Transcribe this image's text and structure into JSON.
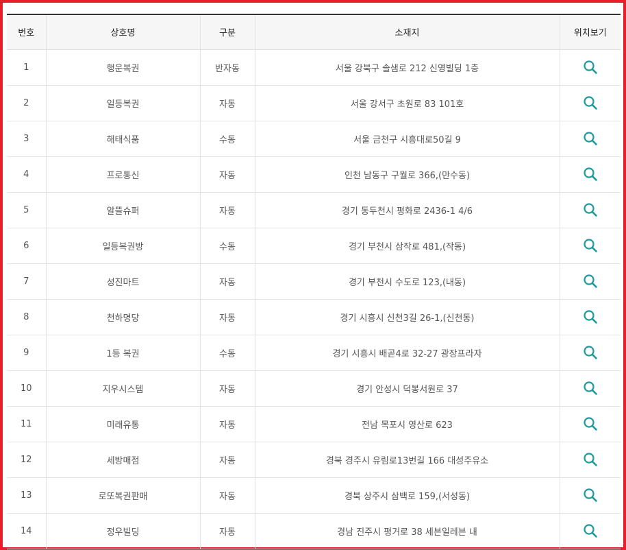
{
  "accent_color": "#1a9a9a",
  "frame_color": "#e5202a",
  "headers": {
    "no": "번호",
    "name": "상호명",
    "type": "구분",
    "address": "소재지",
    "location": "위치보기"
  },
  "rows": [
    {
      "no": "1",
      "name": "행운복권",
      "type": "반자동",
      "address": "서울 강북구 솔샘로 212 신영빌딩 1층",
      "icon": "search-icon"
    },
    {
      "no": "2",
      "name": "일등복권",
      "type": "자동",
      "address": "서울 강서구 초원로 83 101호",
      "icon": "search-icon"
    },
    {
      "no": "3",
      "name": "해태식품",
      "type": "수동",
      "address": "서울 금천구 시흥대로50길 9",
      "icon": "search-icon"
    },
    {
      "no": "4",
      "name": "프로통신",
      "type": "자동",
      "address": "인천 남동구 구월로 366,(만수동)",
      "icon": "search-icon"
    },
    {
      "no": "5",
      "name": "알뜰슈퍼",
      "type": "자동",
      "address": "경기 동두천시 평화로 2436-1 4/6",
      "icon": "search-icon"
    },
    {
      "no": "6",
      "name": "일등복권방",
      "type": "수동",
      "address": "경기 부천시 삼작로 481,(작동)",
      "icon": "search-icon"
    },
    {
      "no": "7",
      "name": "성진마트",
      "type": "자동",
      "address": "경기 부천시 수도로 123,(내동)",
      "icon": "search-icon"
    },
    {
      "no": "8",
      "name": "천하명당",
      "type": "자동",
      "address": "경기 시흥시 신천3길 26-1,(신천동)",
      "icon": "search-icon"
    },
    {
      "no": "9",
      "name": "1등 복권",
      "type": "수동",
      "address": "경기 시흥시 배곧4로 32-27 광장프라자",
      "icon": "search-icon"
    },
    {
      "no": "10",
      "name": "지우시스템",
      "type": "자동",
      "address": "경기 안성시 덕봉서원로 37",
      "icon": "search-icon"
    },
    {
      "no": "11",
      "name": "미래유통",
      "type": "자동",
      "address": "전남 목포시 영산로 623",
      "icon": "search-icon"
    },
    {
      "no": "12",
      "name": "세방매점",
      "type": "자동",
      "address": "경북 경주시 유림로13번길 166 대성주유소",
      "icon": "search-icon"
    },
    {
      "no": "13",
      "name": "로또복권판매",
      "type": "자동",
      "address": "경북 상주시 삼백로 159,(서성동)",
      "icon": "search-icon"
    },
    {
      "no": "14",
      "name": "정우빌딩",
      "type": "자동",
      "address": "경남 진주시 평거로 38 세븐일레븐 내",
      "icon": "search-icon"
    }
  ]
}
